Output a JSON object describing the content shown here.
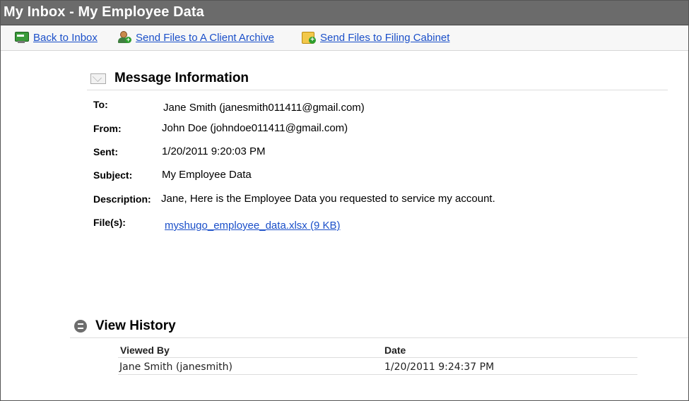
{
  "window": {
    "title": "My Inbox - My Employee Data"
  },
  "toolbar": {
    "back_label": "Back to Inbox",
    "send_archive_label": "Send Files to A Client Archive",
    "send_cabinet_label": "Send Files to Filing Cabinet"
  },
  "message": {
    "heading": "Message Information",
    "to_label": "To:",
    "to_value": "Jane Smith (janesmith011411@gmail.com)",
    "from_label": "From:",
    "from_value": "John Doe (johndoe011411@gmail.com)",
    "sent_label": "Sent:",
    "sent_value": "1/20/2011 9:20:03 PM",
    "subject_label": "Subject:",
    "subject_value": "My Employee Data",
    "description_label": "Description:",
    "description_value": "Jane, Here is the Employee Data you requested to service my account.",
    "files_label": "File(s):",
    "file_link": "myshugo_employee_data.xlsx (9 KB)"
  },
  "history": {
    "heading": "View History",
    "columns": [
      "Viewed By",
      "Date"
    ],
    "rows": [
      {
        "viewed_by": "Jane Smith (janesmith)",
        "date": "1/20/2011 9:24:37 PM"
      }
    ]
  },
  "icons": {
    "back": "back-to-inbox-icon",
    "archive": "client-archive-icon",
    "cabinet": "filing-cabinet-icon",
    "message": "envelope-icon",
    "history": "history-icon"
  }
}
